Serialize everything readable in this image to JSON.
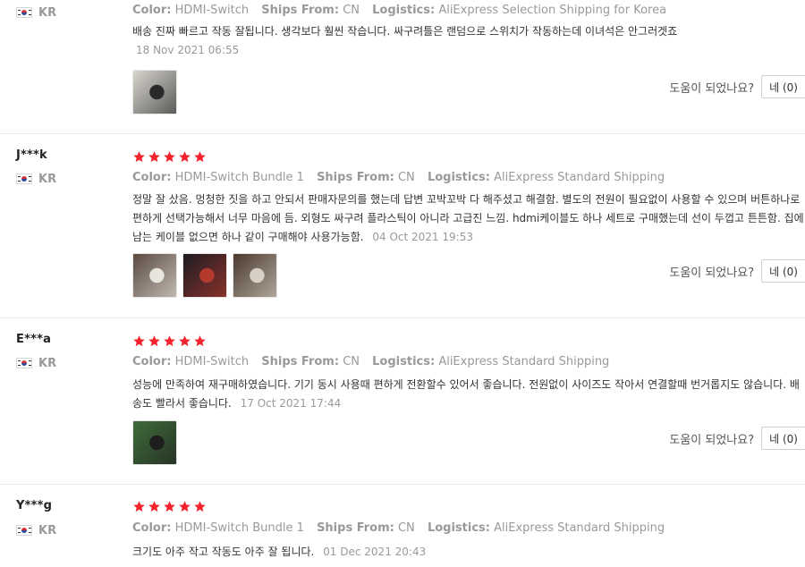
{
  "reviews": [
    {
      "user": "",
      "country": "KR",
      "stars": 5,
      "show_stars": false,
      "color_label": "Color:",
      "color_value": "HDMI-Switch",
      "ships_label": "Ships From:",
      "ships_value": "CN",
      "logistics_label": "Logistics:",
      "logistics_value": "AliExpress Selection Shipping for Korea",
      "text": "배송 진짜 빠르고 작동 잘됩니다. 생각보다 훨씬 작습니다. 싸구려틀은 랜덤으로 스위치가 작동하는데 이녀석은 안그러겟죠",
      "date": "18 Nov 2021 06:55",
      "helpful_label": "도움이 되었나요?",
      "helpful_button": "네 (0)",
      "thumbs": [
        {
          "bg": "#d9d6cf",
          "detail": "#2a2a2a"
        }
      ]
    },
    {
      "user": "J***k",
      "country": "KR",
      "stars": 5,
      "show_stars": true,
      "color_label": "Color:",
      "color_value": "HDMI-Switch Bundle 1",
      "ships_label": "Ships From:",
      "ships_value": "CN",
      "logistics_label": "Logistics:",
      "logistics_value": "AliExpress Standard Shipping",
      "text": "정말 잘 샀음. 멍청한 짓을 하고 안되서 판매자문의를 했는데 답변 꼬박꼬박 다 해주셨고 해결함. 별도의 전원이 필요없이 사용할 수 있으며 버튼하나로 편하게 선택가능해서 너무 마음에 듬. 외형도 싸구려 플라스틱이 아니라 고급진 느낌. hdmi케이블도 하나 세트로 구매했는데 선이 두껍고 튼튼함. 집에 남는 케이블 없으면 하나 같이 구매해야 사용가능함.",
      "date": "04 Oct 2021 19:53",
      "helpful_label": "도움이 되었나요?",
      "helpful_button": "네 (0)",
      "thumbs": [
        {
          "bg": "#5a4a40",
          "detail": "#e8e4de"
        },
        {
          "bg": "#1c1c22",
          "detail": "#b43a2e"
        },
        {
          "bg": "#4a3a30",
          "detail": "#d8d0c4"
        }
      ]
    },
    {
      "user": "E***a",
      "country": "KR",
      "stars": 5,
      "show_stars": true,
      "color_label": "Color:",
      "color_value": "HDMI-Switch",
      "ships_label": "Ships From:",
      "ships_value": "CN",
      "logistics_label": "Logistics:",
      "logistics_value": "AliExpress Standard Shipping",
      "text": "성능에 만족하여 재구매하였습니다. 기기 동시 사용때 편하게 전환할수 있어서 좋습니다. 전원없이 사이즈도 작아서 연결할때 번거롭지도 않습니다. 배송도 빨라서 좋습니다.",
      "date": "17 Oct 2021 17:44",
      "helpful_label": "도움이 되었나요?",
      "helpful_button": "네 (0)",
      "thumbs": [
        {
          "bg": "#3f6b3a",
          "detail": "#1e1e1e"
        }
      ]
    },
    {
      "user": "Y***g",
      "country": "KR",
      "stars": 5,
      "show_stars": true,
      "color_label": "Color:",
      "color_value": "HDMI-Switch Bundle 1",
      "ships_label": "Ships From:",
      "ships_value": "CN",
      "logistics_label": "Logistics:",
      "logistics_value": "AliExpress Standard Shipping",
      "text": "크기도 아주 작고 작동도 아주 잘 됩니다.",
      "date": "01 Dec 2021 20:43",
      "helpful_label": "",
      "helpful_button": "",
      "thumbs": []
    }
  ],
  "colors": {
    "star": "#f5222d",
    "muted": "#999999",
    "text": "#333333",
    "separator": "#ececec"
  }
}
